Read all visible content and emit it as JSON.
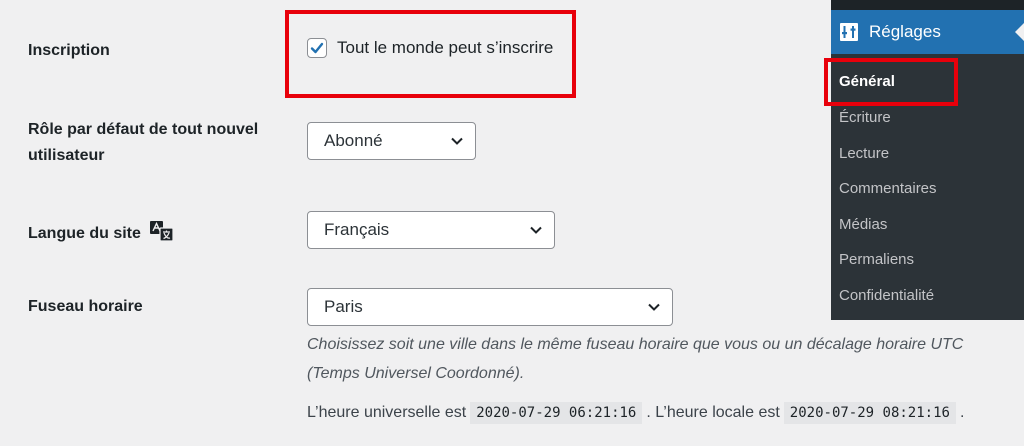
{
  "settings": {
    "registration": {
      "label": "Inscription",
      "checkbox_label": "Tout le monde peut s’inscrire",
      "checked": true
    },
    "default_role": {
      "label_line1": "Rôle par défaut de tout nouvel",
      "label_line2": "utilisateur",
      "value": "Abonné"
    },
    "site_language": {
      "label": "Langue du site",
      "value": "Français"
    },
    "timezone": {
      "label": "Fuseau horaire",
      "value": "Paris",
      "description_line1": "Choisissez soit une ville dans le même fuseau horaire que vous ou un décalage horaire UTC",
      "description_line2": "(Temps Universel Coordonné).",
      "universal_prefix": "L’heure universelle est",
      "universal_time": "2020-07-29 06:21:16",
      "local_prefix": ". L’heure locale est",
      "local_time": "2020-07-29 08:21:16",
      "suffix": "."
    }
  },
  "admin_menu": {
    "section": {
      "label": "Réglages",
      "icon": "settings-sliders-icon"
    },
    "items": [
      {
        "label": "Général",
        "active": true
      },
      {
        "label": "Écriture",
        "active": false
      },
      {
        "label": "Lecture",
        "active": false
      },
      {
        "label": "Commentaires",
        "active": false
      },
      {
        "label": "Médias",
        "active": false
      },
      {
        "label": "Permaliens",
        "active": false
      },
      {
        "label": "Confidentialité",
        "active": false
      }
    ]
  },
  "colors": {
    "accent": "#2271b1",
    "highlight": "#e8000b",
    "menu_bg": "#2c3338"
  }
}
